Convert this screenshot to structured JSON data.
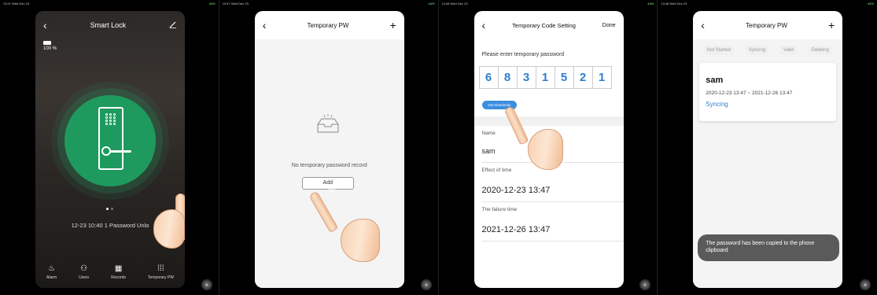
{
  "panel1": {
    "status_left": "13:47  Wed Dec 23",
    "status_right": "44%",
    "title": "Smart Lock",
    "battery": "100 %",
    "record_line": "12-23 10:40  1 Password Unlo",
    "tabs": [
      {
        "label": "Alarm",
        "icon": "alarm-icon"
      },
      {
        "label": "Users",
        "icon": "users-icon"
      },
      {
        "label": "Records",
        "icon": "calendar-icon"
      },
      {
        "label": "Temporary PW",
        "icon": "keypad-icon"
      }
    ]
  },
  "panel2": {
    "status_left": "13:47  Wed Dec 23",
    "status_right": "44%",
    "title": "Temporary PW",
    "empty_text": "No temporary password record",
    "add_label": "Add"
  },
  "panel3": {
    "status_left": "13:48  Wed Dec 23",
    "status_right": "44%",
    "title": "Temporary Code Setting",
    "done_label": "Done",
    "prompt": "Please enter temporary password",
    "digits": [
      "6",
      "8",
      "3",
      "1",
      "5",
      "2",
      "1"
    ],
    "random_label": "Get Randomly",
    "name_label": "Name",
    "name_value": "sam",
    "effect_label": "Effect of time",
    "effect_value": "2020-12-23 13:47",
    "failure_label": "The failure time",
    "failure_value": "2021-12-26 13:47"
  },
  "panel4": {
    "status_left": "13:48  Wed Dec 23",
    "status_right": "44%",
    "title": "Temporary PW",
    "filters": [
      "Not Started",
      "Syncing",
      "Valid",
      "Deleting"
    ],
    "card_name": "sam",
    "card_range": "2020-12-23 13:47 ~ 2021-12-26 13:47",
    "card_status": "Syncing",
    "toast": "The password has been copied to the phone clipboard"
  },
  "colors": {
    "lock_green": "#1f9a5e",
    "accent_blue": "#2f7fd0",
    "button_blue": "#3d8ee0"
  }
}
